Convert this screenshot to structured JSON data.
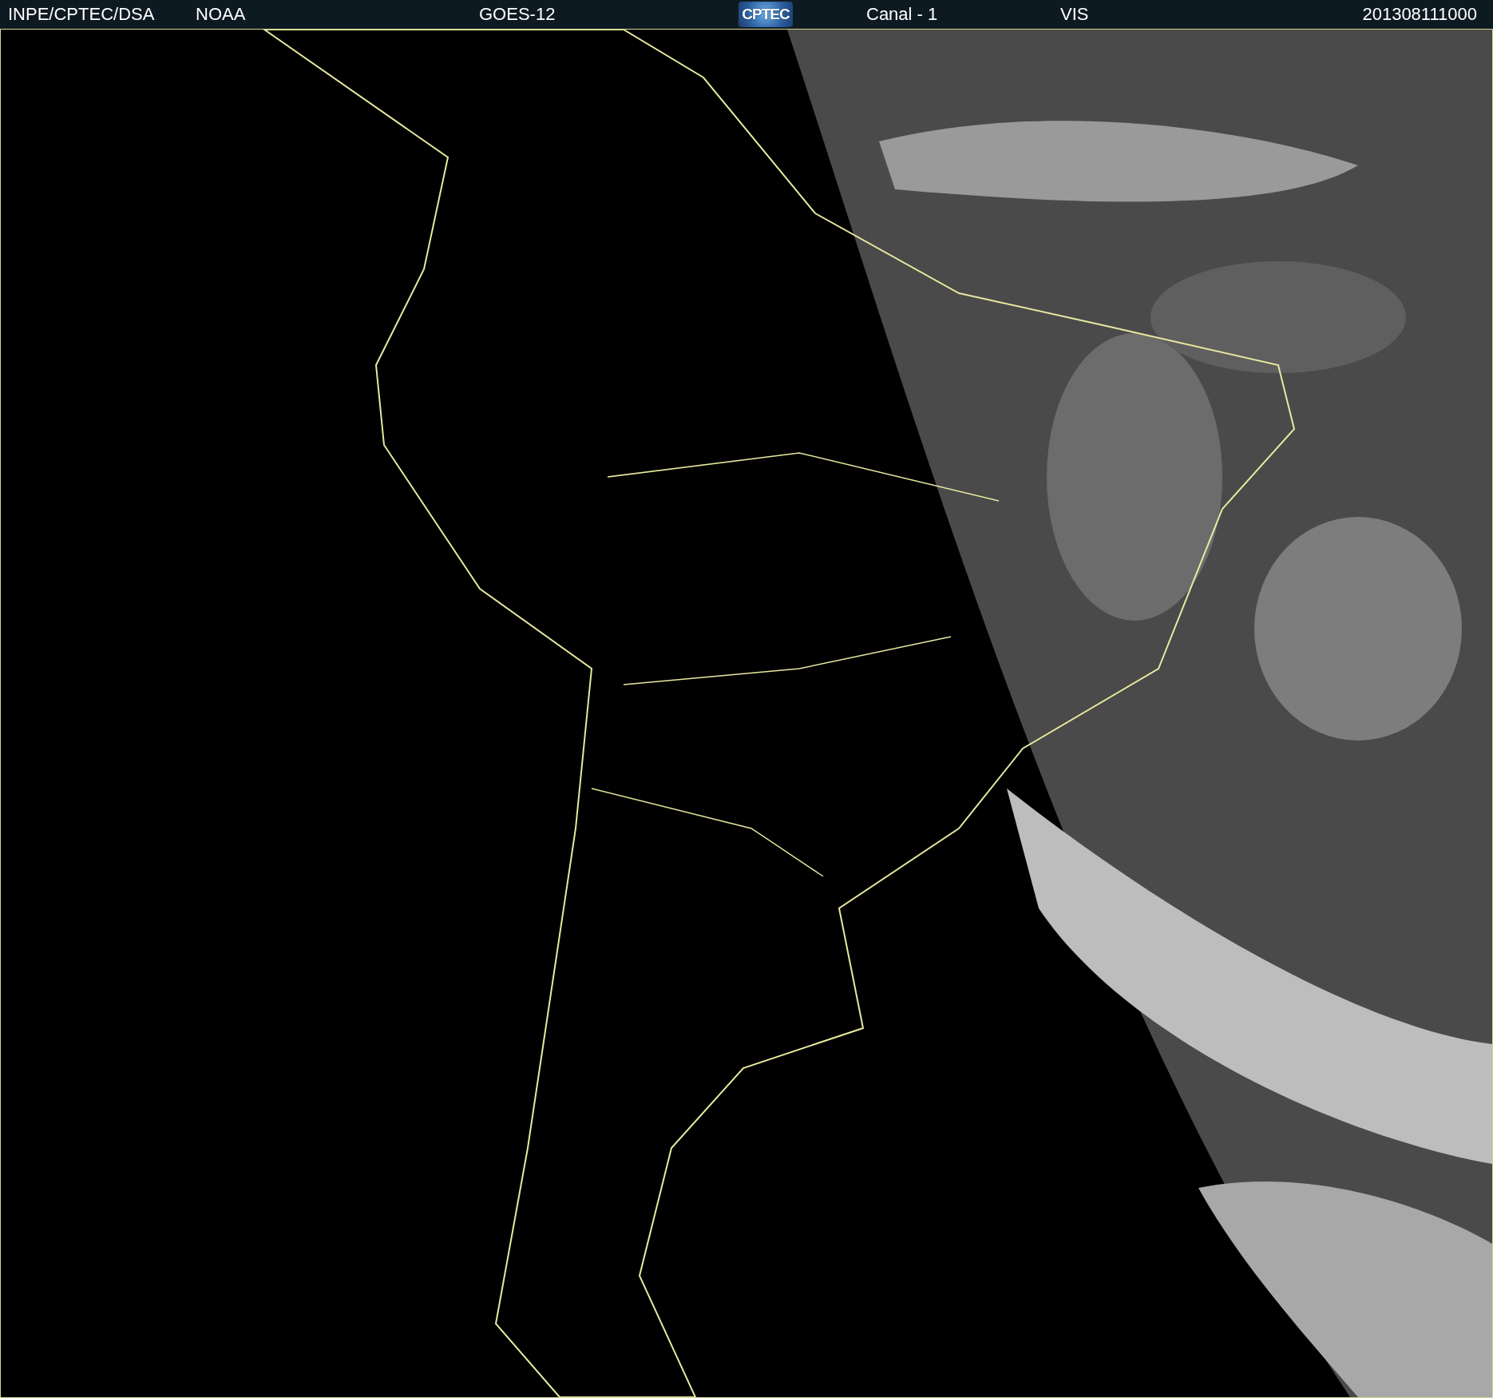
{
  "header": {
    "items": [
      {
        "kind": "text",
        "text": "INPE/CPTEC/DSA"
      },
      {
        "kind": "text",
        "text": "NOAA"
      },
      {
        "kind": "text",
        "text": "GOES-12"
      },
      {
        "kind": "logo",
        "text": "CPTEC"
      },
      {
        "kind": "text",
        "text": "Canal - 1"
      },
      {
        "kind": "text",
        "text": "VIS"
      },
      {
        "kind": "text",
        "text": "201308111000"
      }
    ]
  }
}
